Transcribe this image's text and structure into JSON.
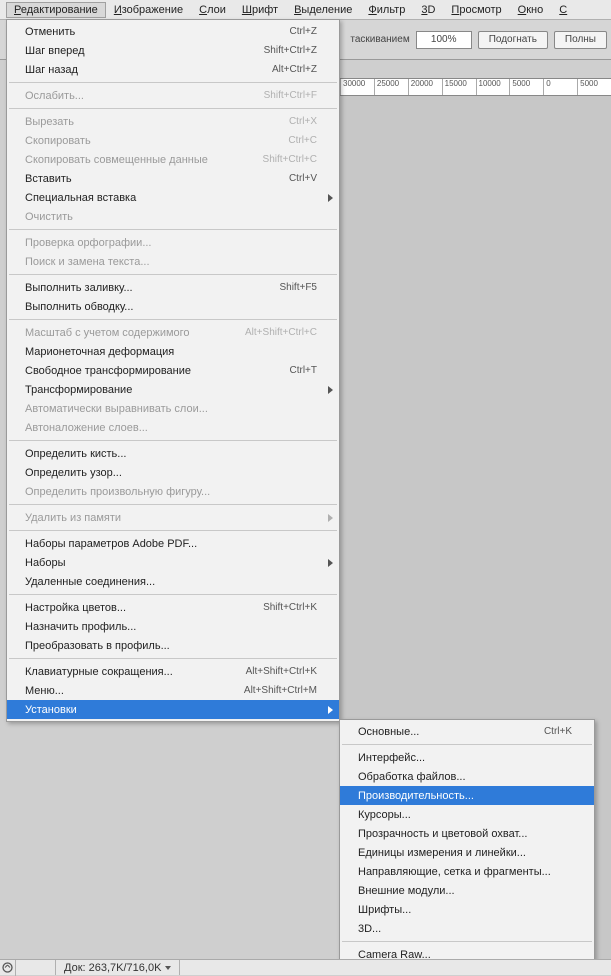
{
  "menubar": {
    "items": [
      {
        "label": "Редактирование",
        "ul": "Р",
        "open": true
      },
      {
        "label": "Изображение",
        "ul": "И"
      },
      {
        "label": "Слои",
        "ul": "С"
      },
      {
        "label": "Шрифт",
        "ul": "Ш"
      },
      {
        "label": "Выделение",
        "ul": "В"
      },
      {
        "label": "Фильтр",
        "ul": "Ф"
      },
      {
        "label": "3D",
        "ul": "3"
      },
      {
        "label": "Просмотр",
        "ul": "П"
      },
      {
        "label": "Окно",
        "ul": "О"
      },
      {
        "label": "С",
        "ul": "С"
      }
    ]
  },
  "options": {
    "drag_text": "таскиванием",
    "zoom_value": "100%",
    "fit_label": "Подогнать",
    "full_label": "Полны"
  },
  "ruler": [
    "30000",
    "25000",
    "20000",
    "15000",
    "10000",
    "5000",
    "0",
    "5000"
  ],
  "status": {
    "doc_label": "Док:",
    "doc_value": "263,7K/716,0K"
  },
  "edit_menu": {
    "groups": [
      [
        {
          "label": "Отменить",
          "shortcut": "Ctrl+Z"
        },
        {
          "label": "Шаг вперед",
          "shortcut": "Shift+Ctrl+Z"
        },
        {
          "label": "Шаг назад",
          "shortcut": "Alt+Ctrl+Z"
        }
      ],
      [
        {
          "label": "Ослабить...",
          "shortcut": "Shift+Ctrl+F",
          "disabled": true
        }
      ],
      [
        {
          "label": "Вырезать",
          "shortcut": "Ctrl+X",
          "disabled": true
        },
        {
          "label": "Скопировать",
          "shortcut": "Ctrl+C",
          "disabled": true
        },
        {
          "label": "Скопировать совмещенные данные",
          "shortcut": "Shift+Ctrl+C",
          "disabled": true
        },
        {
          "label": "Вставить",
          "shortcut": "Ctrl+V"
        },
        {
          "label": "Специальная вставка",
          "submenu": true
        },
        {
          "label": "Очистить",
          "disabled": true
        }
      ],
      [
        {
          "label": "Проверка орфографии...",
          "disabled": true
        },
        {
          "label": "Поиск и замена текста...",
          "disabled": true
        }
      ],
      [
        {
          "label": "Выполнить заливку...",
          "shortcut": "Shift+F5"
        },
        {
          "label": "Выполнить обводку..."
        }
      ],
      [
        {
          "label": "Масштаб с учетом содержимого",
          "shortcut": "Alt+Shift+Ctrl+C",
          "disabled": true
        },
        {
          "label": "Марионеточная деформация"
        },
        {
          "label": "Свободное трансформирование",
          "shortcut": "Ctrl+T"
        },
        {
          "label": "Трансформирование",
          "submenu": true
        },
        {
          "label": "Автоматически выравнивать слои...",
          "disabled": true
        },
        {
          "label": "Автоналожение слоев...",
          "disabled": true
        }
      ],
      [
        {
          "label": "Определить кисть..."
        },
        {
          "label": "Определить узор..."
        },
        {
          "label": "Определить произвольную фигуру...",
          "disabled": true
        }
      ],
      [
        {
          "label": "Удалить из памяти",
          "submenu": true,
          "disabled": true
        }
      ],
      [
        {
          "label": "Наборы параметров Adobe PDF..."
        },
        {
          "label": "Наборы",
          "submenu": true
        },
        {
          "label": "Удаленные соединения..."
        }
      ],
      [
        {
          "label": "Настройка цветов...",
          "shortcut": "Shift+Ctrl+K"
        },
        {
          "label": "Назначить профиль..."
        },
        {
          "label": "Преобразовать в профиль..."
        }
      ],
      [
        {
          "label": "Клавиатурные сокращения...",
          "shortcut": "Alt+Shift+Ctrl+K"
        },
        {
          "label": "Меню...",
          "shortcut": "Alt+Shift+Ctrl+M"
        },
        {
          "label": "Установки",
          "submenu": true,
          "hover": true
        }
      ]
    ]
  },
  "prefs_submenu": {
    "groups": [
      [
        {
          "label": "Основные...",
          "shortcut": "Ctrl+K"
        }
      ],
      [
        {
          "label": "Интерфейс..."
        },
        {
          "label": "Обработка файлов..."
        },
        {
          "label": "Производительность...",
          "hover": true
        },
        {
          "label": "Курсоры..."
        },
        {
          "label": "Прозрачность и цветовой охват..."
        },
        {
          "label": "Единицы измерения и линейки..."
        },
        {
          "label": "Направляющие, сетка и фрагменты..."
        },
        {
          "label": "Внешние модули..."
        },
        {
          "label": "Шрифты..."
        },
        {
          "label": "3D..."
        }
      ],
      [
        {
          "label": "Camera Raw..."
        }
      ]
    ]
  }
}
